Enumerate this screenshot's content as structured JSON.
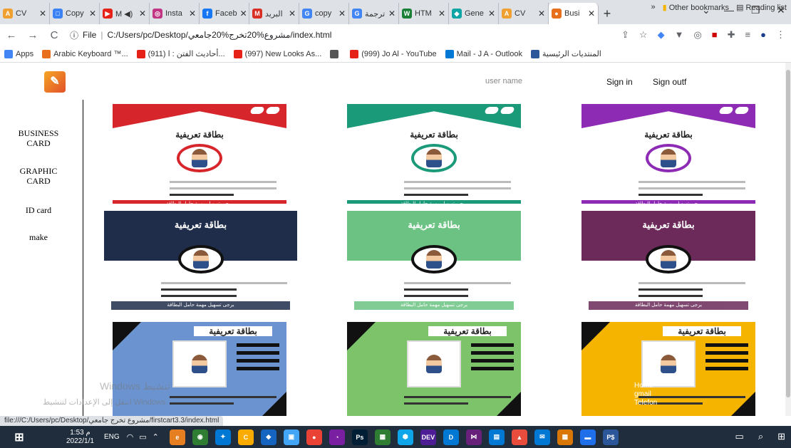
{
  "browser": {
    "tabs": [
      {
        "label": "CV",
        "color": "#f0a030",
        "icon_text": "A"
      },
      {
        "label": "Copy",
        "color": "#3b82f6",
        "icon_text": "□"
      },
      {
        "label": "M ◀)",
        "color": "#e62117",
        "icon_text": "▶"
      },
      {
        "label": "Insta",
        "color": "#c13584",
        "icon_text": "◎"
      },
      {
        "label": "Faceb",
        "color": "#1877f2",
        "icon_text": "f"
      },
      {
        "label": "البريد",
        "color": "#d93025",
        "icon_text": "M"
      },
      {
        "label": "copy",
        "color": "#4285f4",
        "icon_text": "G"
      },
      {
        "label": "ترجمة",
        "color": "#4285f4",
        "icon_text": "G"
      },
      {
        "label": "HTM",
        "color": "#1a7f37",
        "icon_text": "W"
      },
      {
        "label": "Gene",
        "color": "#0ea5a4",
        "icon_text": "◆"
      },
      {
        "label": "CV",
        "color": "#f0a030",
        "icon_text": "A"
      },
      {
        "label": "Busi",
        "color": "#e86f1c",
        "icon_text": "●"
      }
    ],
    "active_tab_index": 11,
    "new_tab_symbol": "+",
    "window_controls": [
      "⌄",
      "—",
      "❐",
      "✕"
    ],
    "back_symbol": "←",
    "forward_symbol": "→",
    "reload_symbol": "C",
    "info_symbol": "ⓘ",
    "url_scheme": "File",
    "url": "C:/Users/pc/Desktop/مشروع%20تخرج%20جامعي/index.html",
    "toolbar_icons": [
      "share-icon",
      "star-icon",
      "extension-icons",
      "menu-icon"
    ]
  },
  "bookmarks": {
    "items": [
      {
        "label": "Apps",
        "color": "#4285f4"
      },
      {
        "label": "Arabic Keyboard ™...",
        "color": "#e86f1c"
      },
      {
        "label": "(911) أحاديث الفتن : ا...",
        "color": "#e62117"
      },
      {
        "label": "(997) New Looks As...",
        "color": "#e62117"
      },
      {
        "label": "",
        "color": "#555555"
      },
      {
        "label": "(999) Jo Al - YouTube",
        "color": "#e62117"
      },
      {
        "label": "Mail - J A - Outlook",
        "color": "#0078d4"
      },
      {
        "label": "المنتديات الرئيسية",
        "color": "#2b579a"
      }
    ],
    "more": "»",
    "other": "Other bookmarks",
    "reading": "Reading list"
  },
  "page": {
    "nav": {
      "user_name": "user name",
      "sign_in": "Sign in",
      "sign_out": "Sign outf"
    },
    "sidebar": [
      {
        "label": "BUSINESS CARD"
      },
      {
        "label": "GRAPHIC CARD"
      },
      {
        "label": "ID card"
      },
      {
        "label": "make"
      }
    ],
    "card_title": "بطاقة تعريفية",
    "card_footer": "يرجى تسهيل مهمة حامل البطاقة",
    "cards": [
      {
        "style": "ribbon",
        "color": "#d7262b"
      },
      {
        "style": "ribbon",
        "color": "#1b9a7a"
      },
      {
        "style": "ribbon",
        "color": "#8e2bb5"
      },
      {
        "style": "wave",
        "color": "#1f2d4a"
      },
      {
        "style": "wave",
        "color": "#6cc283"
      },
      {
        "style": "wave",
        "color": "#6b2a59"
      },
      {
        "style": "geo",
        "color": "#6b93cf"
      },
      {
        "style": "geo",
        "color": "#7cc36a"
      },
      {
        "style": "geo",
        "color": "#f5b400"
      }
    ],
    "overlay_links": [
      "Home",
      "gmail",
      "Telefon"
    ],
    "watermark": "Windows تنشيط",
    "watermark2": "انتقل إلى الإعدادات لتنشيط Windows."
  },
  "status_bar": "file:///C:/Users/pc/Desktop/مشروع تخرج جامعي/firstcart3.3/index.html",
  "taskbar": {
    "time": "1:53 م",
    "date": "2022/1/1",
    "lang": "ENG",
    "apps": [
      {
        "label": "e",
        "color": "#e67e22"
      },
      {
        "label": "◉",
        "color": "#2e7d32"
      },
      {
        "label": "✦",
        "color": "#0078d4"
      },
      {
        "label": "C",
        "color": "#f9ab00"
      },
      {
        "label": "◆",
        "color": "#1565c0"
      },
      {
        "label": "▣",
        "color": "#42a5f5"
      },
      {
        "label": "●",
        "color": "#ea4335"
      },
      {
        "label": "◔",
        "color": "#7b1fa2"
      },
      {
        "label": "Ps",
        "color": "#001e36"
      },
      {
        "label": "▦",
        "color": "#2e7d32"
      },
      {
        "label": "⬢",
        "color": "#0ea5e9"
      },
      {
        "label": "DEV",
        "color": "#4c1d95"
      },
      {
        "label": "D",
        "color": "#0078d4"
      },
      {
        "label": "⋈",
        "color": "#68217a"
      },
      {
        "label": "▤",
        "color": "#0078d4"
      },
      {
        "label": "▲",
        "color": "#e74c3c"
      },
      {
        "label": "✉",
        "color": "#0078d4"
      },
      {
        "label": "▦",
        "color": "#d97706"
      },
      {
        "label": "▬",
        "color": "#1f6feb"
      },
      {
        "label": "P$",
        "color": "#2b579a"
      }
    ],
    "right_icons": [
      "▭",
      "⌕",
      "⊞"
    ]
  }
}
